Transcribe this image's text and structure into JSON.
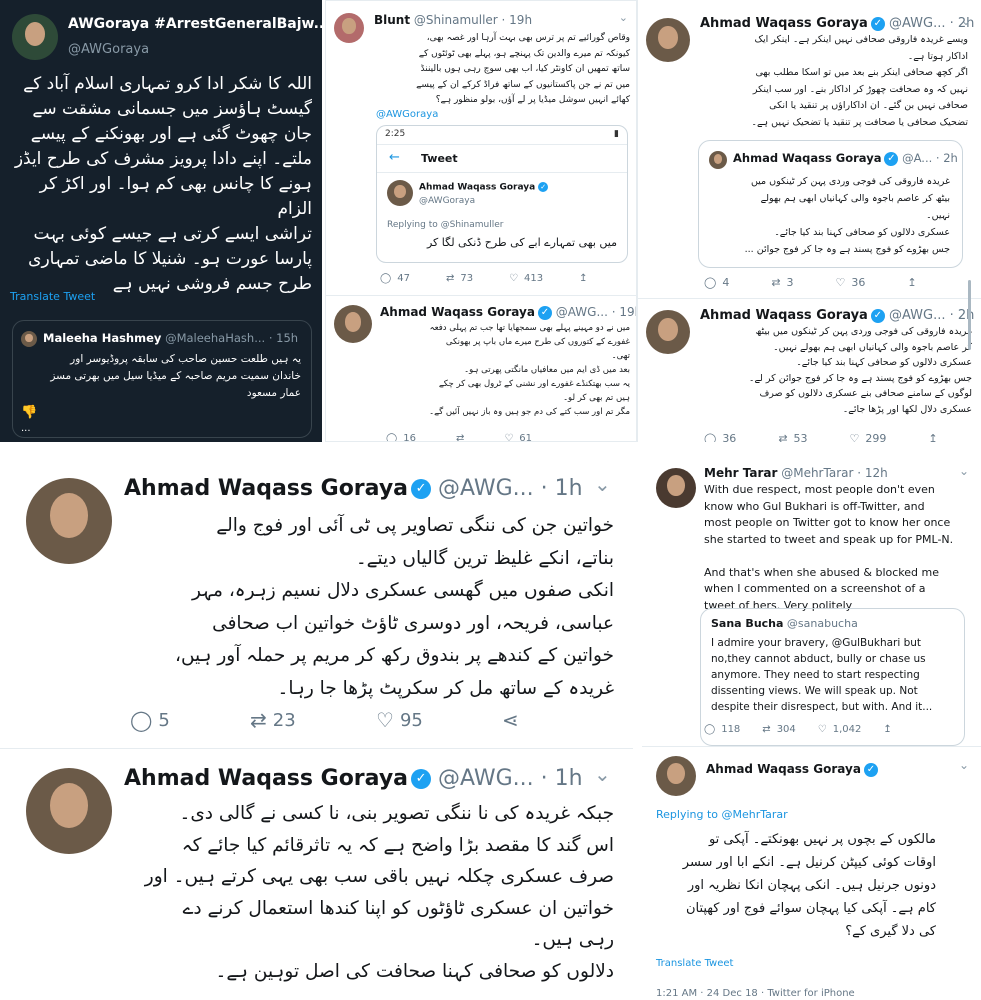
{
  "panel1": {
    "name": "AWGoraya #ArrestGeneralBajw...",
    "handle": "@AWGoraya",
    "text": "اللہ کا شکر ادا کرو تمہاری اسلام آباد کے\nگیسٹ ہاؤسز میں جسمانی مشقت سے\nجان چھوٹ گئی ہے اور بھونکنے کے پیسے\nملتے۔ اپنے دادا پرویز مشرف کی طرح ایڈز\nہونے کا چانس بھی کم ہوا۔ اور اکڑ کر الزام\nتراشی ایسے کرتی ہے جیسے کوئی بہت\nپارسا عورت ہو۔ شنیلا کا ماضی تمہاری\nطرح جسم فروشی نہیں ہے",
    "translate": "Translate Tweet",
    "quote": {
      "name": "Maleeha Hashmey",
      "handle": "@MaleehaHash...",
      "time": "· 15h",
      "text": "یہ ہیں طلعت حسین صاحب کی سابقہ پروڈیوسر اور\nخاندان سمیت مریم صاحبہ کے میڈیا سیل میں بھرتی مسز\nعمار مسعود",
      "more": "..."
    }
  },
  "panel2": {
    "name": "Blunt",
    "handle": "@Shinamuller",
    "time": "· 19h",
    "text": "وقاص گورائیے تم پر ترس بھی بہت آرہا اور غصہ بھی،\nکیونکہ تم میرے والدین تک پہنچے ہو، پہلے بھی ٹوئٹوں کے\nساتھ تمھیں ان کاونٹر کیا، اب بھی سوچ رہی ہوں بالیننڈ\nمیں تم نے جن پاکستانیوں کے ساتھ فراڈ کرکے ان کے پیسے\nکھائے انہیں سوشل میڈیا پر لے آؤں، بولو منظور ہے؟",
    "mention": "@AWGoraya",
    "phone": {
      "clock": "2:25",
      "header": "Tweet",
      "name": "Ahmad Waqass Goraya",
      "handle": "@AWGoraya",
      "replying": "Replying to @Shinamuller",
      "text": "میں بھی تمہارے ابے کی طرح ڈنکی لگا کر"
    },
    "stats": {
      "replies": "47",
      "retweets": "73",
      "likes": "413"
    },
    "reply": {
      "name": "Ahmad Waqass Goraya",
      "handle": "@AWG...",
      "time": "· 19h",
      "text": "میں نے دو مہینے پہلے بھی سمجھایا تھا جب تم پہلی دفعہ\nغفورے کے کتوروں کی طرح میرے ماں باپ پر بھونکی\nتھی۔\nبعد میں ڈی ایم میں معافیاں مانگتی پھرتی ہو۔\nیہ سب بھتکنڈے غفورے اور نشنی کے ٹرول بھی کر چکے\nہیں تم بھی کر لو۔\nمگر تم اور سب کتے کی دم جو ہیں وہ باز نہیں آئیں گے۔",
      "stats": {
        "replies": "16",
        "retweets": "",
        "likes": "61"
      }
    }
  },
  "panel3": {
    "name": "Ahmad Waqass Goraya",
    "handle": "@AWG...",
    "time": "· 2h",
    "text": "ویسے غریدہ فاروقی صحافی نہیں اینکر ہے۔ اینکر ایک\nاداکار ہوتا ہے۔\nاگر کچھ صحافی اینکر بنے بعد میں تو اسکا مطلب بھی\nنہیں کہ وہ صحافت چھوڑ کر اداکار بنے۔ اور سب اینکر\nصحافی نہیں بن گئے۔ ان اداکاراؤں پر تنقید یا انکی\nتضحیک صحافی یا صحافت پر تنقید یا تضحیک نہیں ہے۔",
    "quote": {
      "name": "Ahmad Waqass Goraya",
      "handle": "@A...",
      "time": "· 2h",
      "text": "غریدہ فاروقی کی فوجی وردی پہن کر ٹینکوں میں\nبیٹھ کر عاصم باجوہ والی کہانیاں ابھی ہم بھولے\nنہیں۔\nعسکری دلالوں کو صحافی کہنا بند کیا جائے۔\nجس بھڑوے کو فوج پسند ہے وہ جا کر فوج جوائن ..."
    },
    "stats": {
      "replies": "4",
      "retweets": "3",
      "likes": "36"
    },
    "tweet2": {
      "name": "Ahmad Waqass Goraya",
      "handle": "@AWG...",
      "time": "· 2h",
      "text": "غریدہ فاروقی کی فوجی وردی پہن کر ٹینکوں میں بیٹھ\nکر عاصم باجوہ والی کہانیاں ابھی ہم بھولے نہیں۔\nعسکری دلالوں کو صحافی کہنا بند کیا جائے۔\nجس بھڑوے کو فوج پسند ہے وہ جا کر فوج جوائن کر لے۔\nلوگوں کے سامنے صحافی بنے عسکری دلالوں کو صرف\nعسکری دلال لکھا اور پڑھا جائے۔",
      "stats": {
        "replies": "36",
        "retweets": "53",
        "likes": "299"
      }
    }
  },
  "panel4": {
    "tweets": [
      {
        "name": "Ahmad Waqass Goraya",
        "handle": "@AWG...",
        "time": "· 1h",
        "text": "خواتین جن کی ننگی تصاویر پی ٹی آئی اور فوج والے\nبناتے، انکے غلیظ ترین گالیاں دیتے۔\nانکی صفوں میں گھسی عسکری دلال نسیم زہرہ، مہر\nعباسی، فریحہ، اور دوسری ٹاؤٹ خواتین اب صحافی\nخواتین کے کندھے پر بندوق رکھ کر مریم پر حملہ آور ہیں،\nغریدہ کے ساتھ مل کر سکرپٹ پڑھا جا رہا۔",
        "replies": "5",
        "retweets": "23",
        "likes": "95"
      },
      {
        "name": "Ahmad Waqass Goraya",
        "handle": "@AWG...",
        "time": "· 1h",
        "text": "جبکہ غریدہ کی نا ننگی تصویر بنی، نا کسی نے گالی دی۔\nاس گند کا مقصد بڑا واضح ہے کہ یہ تاثرقائم کیا جائے کہ\nصرف عسکری چکلہ نہیں باقی سب بھی یہی کرتے ہیں۔ اور\nخواتین ان عسکری ٹاؤٹوں کو اپنا کندھا استعمال کرنے دے\nرہی ہیں۔\nدلالوں کو صحافی کہنا صحافت کی اصل توہین ہے۔",
        "replies": "",
        "retweets": "",
        "likes": ""
      }
    ]
  },
  "panel5": {
    "name": "Mehr Tarar",
    "handle": "@MehrTarar",
    "time": "· 12h",
    "text": "With due respect, most people don't even\nknow who Gul Bukhari is off-Twitter, and\nmost people on Twitter got to know her once\nshe started to tweet and speak up for PML-N.\n\nAnd that's when she abused & blocked me\nwhen I commented on a screenshot of a\ntweet of hers. Very politely",
    "quote": {
      "name": "Sana Bucha",
      "handle": "@sanabucha",
      "text": "I admire your bravery, @GulBukhari but\nno,they cannot abduct, bully or chase us\nanymore. They need to start respecting\ndissenting views. We will speak up. Not\ndespite their disrespect, but with. And it..."
    },
    "stats": {
      "replies": "118",
      "retweets": "304",
      "likes": "1,042"
    },
    "reply": {
      "name": "Ahmad Waqass Goraya",
      "replying": "Replying to @MehrTarar",
      "text": "مالکوں کے بچوں پر نہیں بھونکتے۔ آپکی تو\nاوقات کوئی کیپٹن کرنیل ہے۔ انکے ابا اور سسر\nدونوں جرنیل ہیں۔ انکی پہچان انکا نظریہ اور\nکام ہے۔ آپکی کیا پہچان سوائے فوج اور کھپتان\nکی دلا گیری کے؟",
      "translate": "Translate Tweet",
      "footer": "1:21 AM · 24 Dec 18 · Twitter for iPhone"
    }
  },
  "colors": {
    "dark_bg": "#15202b",
    "accent": "#1da1f2",
    "text": "#14171a",
    "muted": "#657786"
  }
}
